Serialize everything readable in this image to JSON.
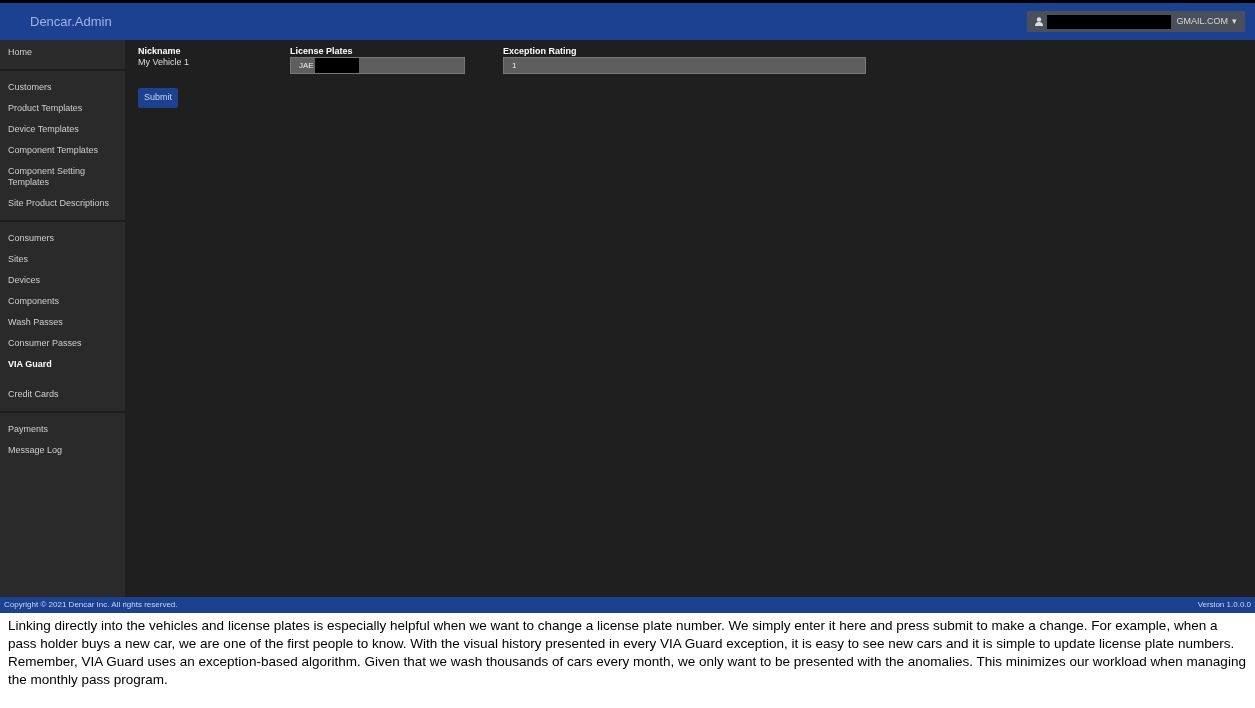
{
  "navbar": {
    "brand": "Dencar.Admin",
    "user_email": "GMAIL.COM",
    "caret": "▾"
  },
  "sidebar": {
    "groups": [
      {
        "items": [
          {
            "label": "Home",
            "selected": false
          }
        ]
      },
      {
        "items": [
          {
            "label": "Customers",
            "selected": false
          },
          {
            "label": "Product Templates",
            "selected": false
          },
          {
            "label": "Device Templates",
            "selected": false
          },
          {
            "label": "Component Templates",
            "selected": false
          },
          {
            "label": "Component Setting Templates",
            "selected": false
          },
          {
            "label": "Site Product Descriptions",
            "selected": false
          }
        ]
      },
      {
        "items": [
          {
            "label": "Consumers",
            "selected": false
          },
          {
            "label": "Sites",
            "selected": false
          },
          {
            "label": "Devices",
            "selected": false
          },
          {
            "label": "Components",
            "selected": false
          },
          {
            "label": "Wash Passes",
            "selected": false
          },
          {
            "label": "Consumer Passes",
            "selected": false
          },
          {
            "label": "VIA Guard",
            "selected": true
          },
          {
            "label": "Credit Cards",
            "selected": false
          }
        ]
      },
      {
        "items": [
          {
            "label": "Payments",
            "selected": false
          },
          {
            "label": "Message Log",
            "selected": false
          }
        ]
      }
    ]
  },
  "form": {
    "nickname": {
      "label": "Nickname",
      "value": "My Vehicle 1"
    },
    "license_plates": {
      "label": "License Plates",
      "value": "JAE"
    },
    "exception_rating": {
      "label": "Exception Rating",
      "value": "1"
    },
    "submit": "Submit"
  },
  "footer": {
    "copyright": "Copyright © 2021 Dencar Inc. All rights reserved.",
    "version": "Version 1.0.0.0"
  },
  "caption": "Linking directly into the vehicles and license plates is especially helpful when we want to change a license plate number.  We simply enter it here and press submit to make a change.  For example, when a pass holder buys a new car, we are one of the first people to know.  With the visual history presented in every VIA Guard exception, it is easy to see new cars and it is simple to update license plate numbers.  Remember, VIA Guard uses an exception-based algorithm.  Given that we wash thousands of cars every month, we only want to be presented with the anomalies.  This minimizes our workload when managing the monthly pass program."
}
